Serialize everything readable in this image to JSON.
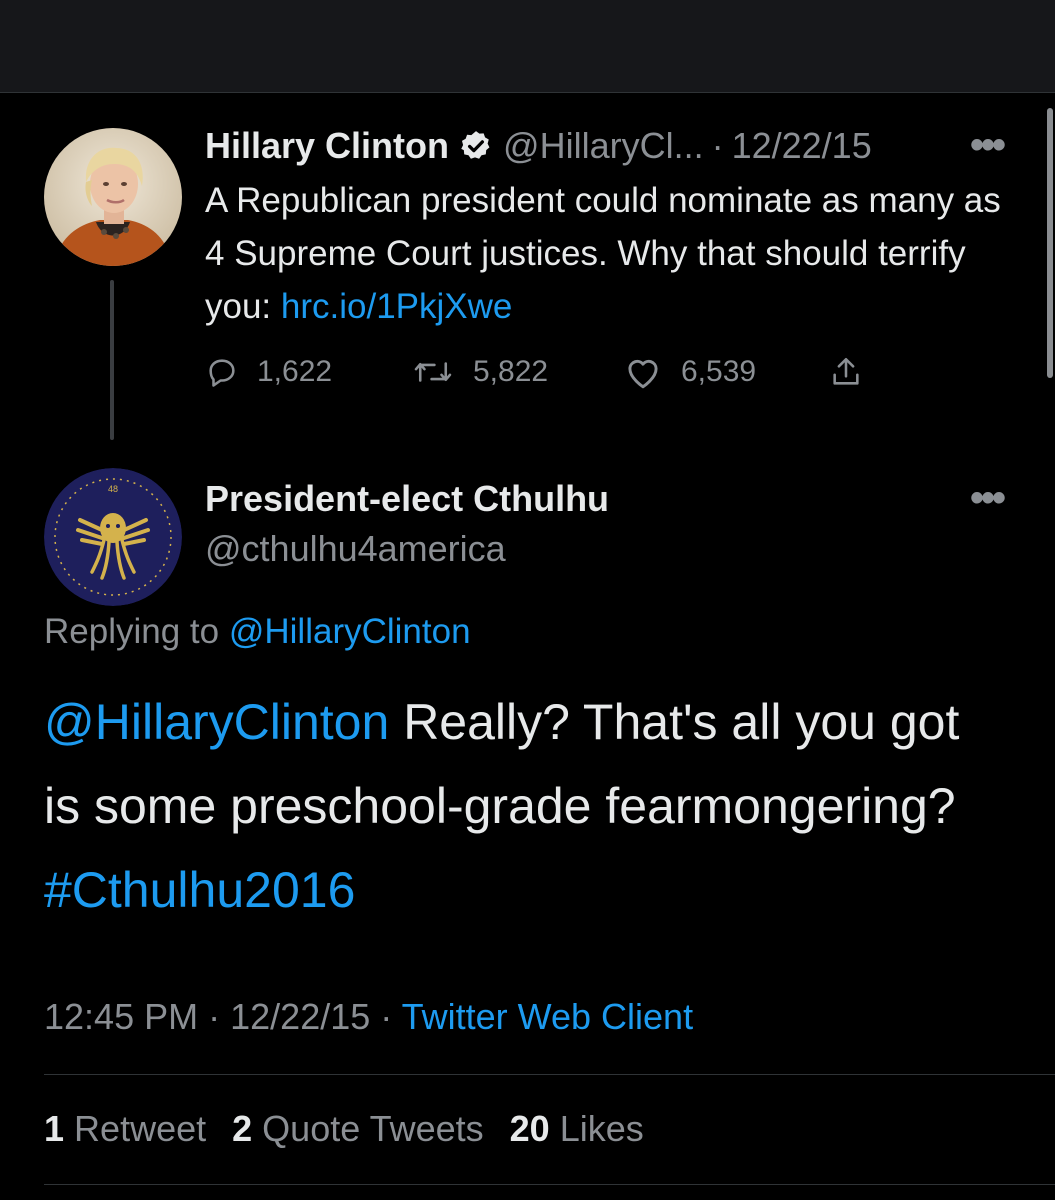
{
  "tweet1": {
    "name": "Hillary Clinton",
    "handle": "@HillaryCl...",
    "separator": "·",
    "date": "12/22/15",
    "text_plain": "A Republican president could nominate as many as 4 Supreme Court justices. Why that should terrify you: ",
    "link": "hrc.io/1PkjXwe",
    "replies": "1,622",
    "retweets": "5,822",
    "likes": "6,539",
    "icons": [
      "verified-badge-icon",
      "more-icon",
      "reply-icon",
      "retweet-icon",
      "like-icon",
      "share-icon"
    ]
  },
  "tweet2": {
    "name": "President-elect Cthulhu",
    "handle": "@cthulhu4america",
    "replying_prefix": "Replying to",
    "replying_to": "@HillaryClinton",
    "mention": "@HillaryClinton",
    "text_plain": " Really? That's all you got is some preschool-grade fearmongering? ",
    "hashtag": "#Cthulhu2016",
    "time": "12:45 PM",
    "date": "12/22/15",
    "separator": "·",
    "client": "Twitter Web Client",
    "avatar_badge_number": "48"
  },
  "stats": {
    "retweet_count": "1",
    "retweet_label": "Retweet",
    "quote_count": "2",
    "quote_label": "Quote Tweets",
    "like_count": "20",
    "like_label": "Likes"
  },
  "colors": {
    "background": "#000000",
    "text": "#e7e9ea",
    "muted": "#8b8f94",
    "link": "#1d9bf0",
    "avatar2_bg": "#1e1f5c",
    "avatar2_gold": "#d4b24c"
  }
}
